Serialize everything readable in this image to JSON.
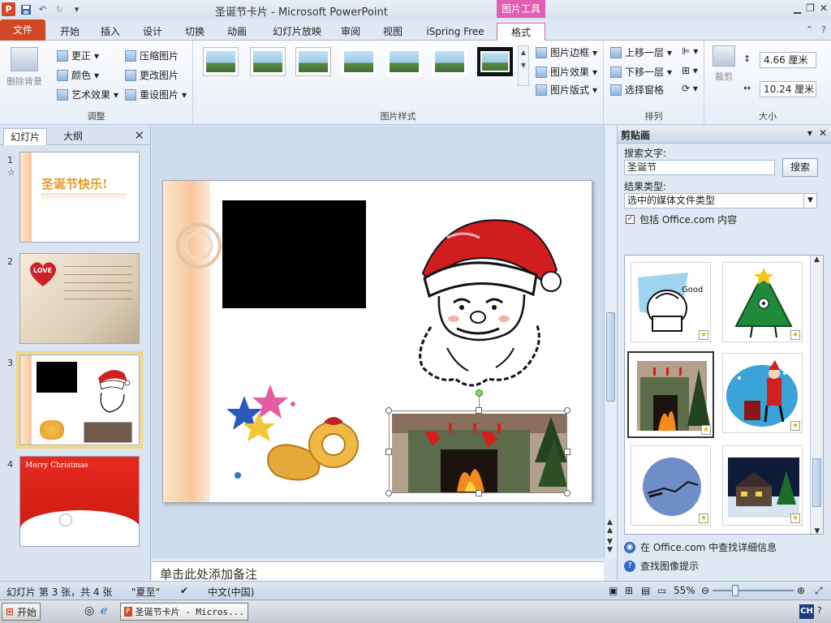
{
  "window": {
    "title": "圣诞节卡片 - Microsoft PowerPoint",
    "tool_tab_header": "图片工具"
  },
  "ribbon_tabs": [
    "文件",
    "开始",
    "插入",
    "设计",
    "切换",
    "动画",
    "幻灯片放映",
    "审阅",
    "视图",
    "iSpring Free",
    "格式"
  ],
  "ribbon": {
    "remove_bg": "删除背景",
    "corrections": "更正",
    "color": "颜色",
    "artistic": "艺术效果",
    "compress": "压缩图片",
    "change": "更改图片",
    "reset": "重设图片",
    "adjust_label": "调整",
    "border": "图片边框",
    "effects": "图片效果",
    "layout": "图片版式",
    "styles_label": "图片样式",
    "bring_forward": "上移一层",
    "send_backward": "下移一层",
    "selection_pane": "选择窗格",
    "arrange_label": "排列",
    "crop": "裁剪",
    "height": "4.66 厘米",
    "width": "10.24 厘米",
    "size_label": "大小"
  },
  "left_panel": {
    "tab_slides": "幻灯片",
    "tab_outline": "大纲",
    "slide_numbers": [
      "1",
      "2",
      "3",
      "4"
    ],
    "slide1_text": "圣诞节快乐!",
    "slide2_love": "LOVE",
    "slide4_text": "Merry Christmas"
  },
  "notes_placeholder": "单击此处添加备注",
  "clip_art": {
    "title": "剪贴画",
    "search_label": "搜索文字:",
    "search_value": "圣诞节",
    "search_button": "搜索",
    "result_type_label": "结果类型:",
    "result_type_value": "选中的媒体文件类型",
    "include_office": "包括 Office.com 内容",
    "find_more": "在 Office.com 中查找详细信息",
    "image_tips": "查找图像提示",
    "clip1_text": "Good"
  },
  "status": {
    "slide_info": "幻灯片 第 3 张，共 4 张",
    "theme": "\"夏至\"",
    "language": "中文(中国)",
    "zoom": "55%"
  },
  "taskbar": {
    "start": "开始",
    "task": "圣诞节卡片 - Micros...",
    "ime": "CH"
  },
  "colors": {
    "file_tab": "#d24726",
    "picture_tools": "#e25db5",
    "ribbon_bg": "#e7eef7"
  }
}
